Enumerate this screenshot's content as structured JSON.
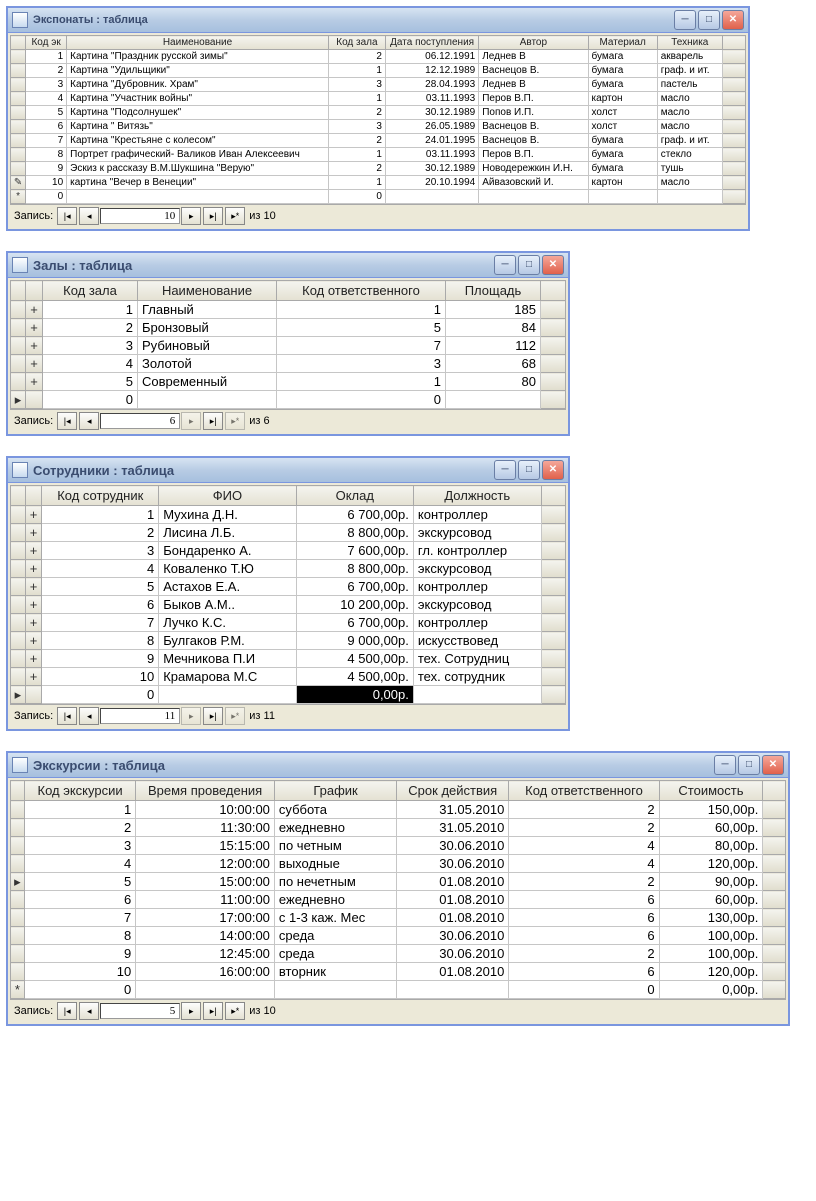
{
  "window1": {
    "title": "Экспонаты : таблица",
    "cols": [
      "Код эк",
      "Наименование",
      "Код зала",
      "Дата поступления",
      "Автор",
      "Материал",
      "Техника"
    ],
    "rows": [
      {
        "id": "1",
        "name": "Картина \"Праздник русской зимы\"",
        "hall": "2",
        "date": "06.12.1991",
        "author": "Леднев В",
        "mat": "бумага",
        "tech": "акварель"
      },
      {
        "id": "2",
        "name": "Картина \"Удильщики\"",
        "hall": "1",
        "date": "12.12.1989",
        "author": "Васнецов В.",
        "mat": "бумага",
        "tech": "граф. и ит."
      },
      {
        "id": "3",
        "name": "Картина \"Дубровник. Храм\"",
        "hall": "3",
        "date": "28.04.1993",
        "author": "Леднев В",
        "mat": "бумага",
        "tech": "пастель"
      },
      {
        "id": "4",
        "name": "Картина \"Участник войны\"",
        "hall": "1",
        "date": "03.11.1993",
        "author": "Перов В.П.",
        "mat": "картон",
        "tech": "масло"
      },
      {
        "id": "5",
        "name": "Картина \"Подсолнушек\"",
        "hall": "2",
        "date": "30.12.1989",
        "author": "Попов И.П.",
        "mat": "холст",
        "tech": "масло"
      },
      {
        "id": "6",
        "name": "Картина \" Витязь\"",
        "hall": "3",
        "date": "26.05.1989",
        "author": "Васнецов В.",
        "mat": "холст",
        "tech": "масло"
      },
      {
        "id": "7",
        "name": "Картина \"Крестьяне с колесом\"",
        "hall": "2",
        "date": "24.01.1995",
        "author": "Васнецов В.",
        "mat": "бумага",
        "tech": "граф. и ит."
      },
      {
        "id": "8",
        "name": "Портрет графический- Валиков Иван Алексеевич",
        "hall": "1",
        "date": "03.11.1993",
        "author": "Перов В.П.",
        "mat": "бумага",
        "tech": "стекло"
      },
      {
        "id": "9",
        "name": "Эскиз к рассказу В.М.Шукшина \"Верую\"",
        "hall": "2",
        "date": "30.12.1989",
        "author": "Новодережкин И.Н.",
        "mat": "бумага",
        "tech": "тушь"
      },
      {
        "id": "10",
        "name": "картина \"Вечер в Венеции\"",
        "hall": "1",
        "date": "20.10.1994",
        "author": "Айвазовский И.",
        "mat": "картон",
        "tech": "масло"
      }
    ],
    "newrow_id": "0",
    "newrow_hall": "0",
    "nav_label": "Запись:",
    "nav_value": "10",
    "nav_total": "из  10"
  },
  "window2": {
    "title": "Залы : таблица",
    "cols": [
      "Код зала",
      "Наименование",
      "Код ответственного",
      "Площадь"
    ],
    "rows": [
      {
        "id": "1",
        "name": "Главный",
        "resp": "1",
        "area": "185"
      },
      {
        "id": "2",
        "name": "Бронзовый",
        "resp": "5",
        "area": "84"
      },
      {
        "id": "3",
        "name": "Рубиновый",
        "resp": "7",
        "area": "112"
      },
      {
        "id": "4",
        "name": "Золотой",
        "resp": "3",
        "area": "68"
      },
      {
        "id": "5",
        "name": "Современный",
        "resp": "1",
        "area": "80"
      }
    ],
    "newrow_id": "0",
    "newrow_resp": "0",
    "nav_label": "Запись:",
    "nav_value": "6",
    "nav_total": "из  6"
  },
  "window3": {
    "title": "Сотрудники : таблица",
    "cols": [
      "Код сотрудник",
      "ФИО",
      "Оклад",
      "Должность"
    ],
    "rows": [
      {
        "id": "1",
        "fio": "Мухина Д.Н.",
        "salary": "6 700,00р.",
        "pos": "контроллер"
      },
      {
        "id": "2",
        "fio": "Лисина Л.Б.",
        "salary": "8 800,00р.",
        "pos": "экскурсовод"
      },
      {
        "id": "3",
        "fio": "Бондаренко А.",
        "salary": "7 600,00р.",
        "pos": "гл. контроллер"
      },
      {
        "id": "4",
        "fio": "Коваленко Т.Ю",
        "salary": "8 800,00р.",
        "pos": "экскурсовод"
      },
      {
        "id": "5",
        "fio": "Астахов Е.А.",
        "salary": "6 700,00р.",
        "pos": "контроллер"
      },
      {
        "id": "6",
        "fio": "Быков А.М..",
        "salary": "10 200,00р.",
        "pos": "экскурсовод"
      },
      {
        "id": "7",
        "fio": "Лучко К.С.",
        "salary": "6 700,00р.",
        "pos": "контроллер"
      },
      {
        "id": "8",
        "fio": "Булгаков Р.М.",
        "salary": "9 000,00р.",
        "pos": "искусствовед"
      },
      {
        "id": "9",
        "fio": "Мечникова П.И",
        "salary": "4 500,00р.",
        "pos": "тех. Сотрудниц"
      },
      {
        "id": "10",
        "fio": "Крамарова М.С",
        "salary": "4 500,00р.",
        "pos": "тех. сотрудник"
      }
    ],
    "newrow_id": "0",
    "newrow_salary": "0,00р.",
    "nav_label": "Запись:",
    "nav_value": "11",
    "nav_total": "из  11"
  },
  "window4": {
    "title": "Экскурсии : таблица",
    "cols": [
      "Код экскурсии",
      "Время проведения",
      "График",
      "Срок действия",
      "Код ответственного",
      "Стоимость"
    ],
    "rows": [
      {
        "id": "1",
        "time": "10:00:00",
        "sched": "суббота",
        "until": "31.05.2010",
        "resp": "2",
        "cost": "150,00р."
      },
      {
        "id": "2",
        "time": "11:30:00",
        "sched": "ежедневно",
        "until": "31.05.2010",
        "resp": "2",
        "cost": "60,00р."
      },
      {
        "id": "3",
        "time": "15:15:00",
        "sched": "по четным",
        "until": "30.06.2010",
        "resp": "4",
        "cost": "80,00р."
      },
      {
        "id": "4",
        "time": "12:00:00",
        "sched": "выходные",
        "until": "30.06.2010",
        "resp": "4",
        "cost": "120,00р."
      },
      {
        "id": "5",
        "time": "15:00:00",
        "sched": "по нечетным",
        "until": "01.08.2010",
        "resp": "2",
        "cost": "90,00р."
      },
      {
        "id": "6",
        "time": "11:00:00",
        "sched": "ежедневно",
        "until": "01.08.2010",
        "resp": "6",
        "cost": "60,00р."
      },
      {
        "id": "7",
        "time": "17:00:00",
        "sched": "с 1-3 каж. Мес",
        "until": "01.08.2010",
        "resp": "6",
        "cost": "130,00р."
      },
      {
        "id": "8",
        "time": "14:00:00",
        "sched": "среда",
        "until": "30.06.2010",
        "resp": "6",
        "cost": "100,00р."
      },
      {
        "id": "9",
        "time": "12:45:00",
        "sched": "среда",
        "until": "30.06.2010",
        "resp": "2",
        "cost": "100,00р."
      },
      {
        "id": "10",
        "time": "16:00:00",
        "sched": "вторник",
        "until": "01.08.2010",
        "resp": "6",
        "cost": "120,00р."
      }
    ],
    "newrow_id": "0",
    "newrow_resp": "0",
    "newrow_cost": "0,00р.",
    "nav_label": "Запись:",
    "nav_value": "5",
    "nav_total": "из  10"
  }
}
